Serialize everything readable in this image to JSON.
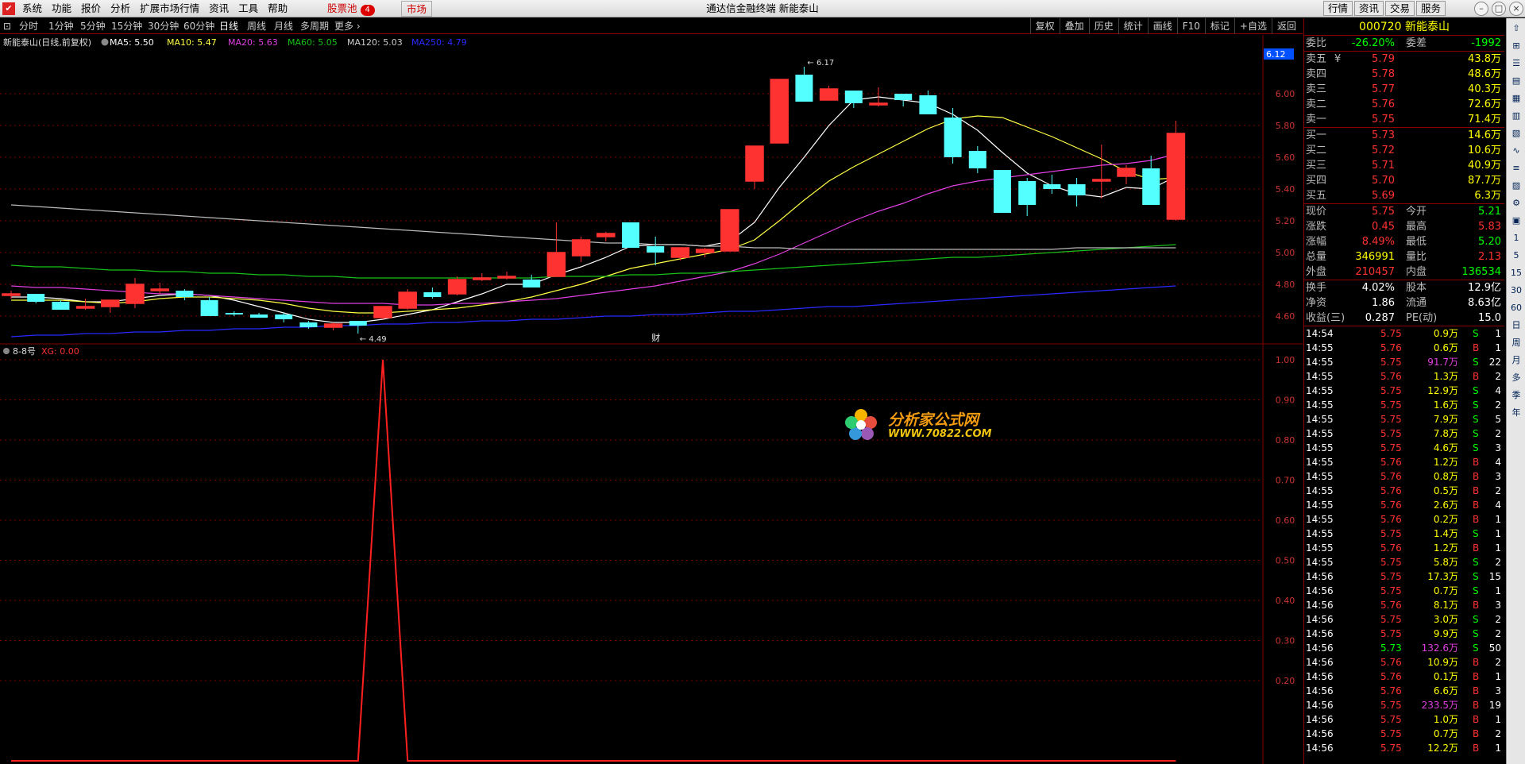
{
  "titlebar": {
    "menus": [
      "系统",
      "功能",
      "报价",
      "分析",
      "扩展市场行情",
      "资讯",
      "工具",
      "帮助"
    ],
    "stock_pool": "股票池",
    "stock_pool_badge": "4",
    "market": "市场",
    "app_title": "通达信金融终端  新能泰山",
    "buttons": [
      "行情",
      "资讯",
      "交易",
      "服务"
    ]
  },
  "periodbar": {
    "items": [
      "分时",
      "1分钟",
      "5分钟",
      "15分钟",
      "30分钟",
      "60分钟",
      "日线",
      "周线",
      "月线",
      "多周期",
      "更多"
    ],
    "active": "日线",
    "chart_buttons": [
      "复权",
      "叠加",
      "历史",
      "统计",
      "画线",
      "F10",
      "标记",
      "+自选",
      "返回"
    ]
  },
  "main_header": {
    "name": "新能泰山(日线,前复权)",
    "ma5": "MA5: 5.50",
    "ma10": "MA10: 5.47",
    "ma20": "MA20: 5.63",
    "ma60": "MA60: 5.05",
    "ma120": "MA120: 5.03",
    "ma250": "MA250: 4.79",
    "high_label": "6.17",
    "low_label": "4.49",
    "fin_label": "财",
    "price_tag": "6.12"
  },
  "sub_header": {
    "name": "8-8号",
    "value": "XG: 0.00"
  },
  "watermark": {
    "line1": "分析家公式网",
    "line2": "WWW.70822.COM"
  },
  "colors": {
    "up": "#ff3232",
    "down": "#54ffff",
    "ma5": "#ffffff",
    "ma10": "#ffff44",
    "ma20": "#e040e0",
    "ma60": "#18c018",
    "ma120": "#bbbbbb",
    "ma250": "#2a2aff",
    "grid": "#800000"
  },
  "chart_data": [
    {
      "type": "candlestick",
      "title": "新能泰山(日线,前复权)",
      "y_ticks": [
        4.6,
        4.8,
        5.0,
        5.2,
        5.4,
        5.6,
        5.8,
        6.0
      ],
      "ylim": [
        4.42,
        6.25
      ],
      "candles": [
        [
          4.73,
          4.76,
          4.71,
          4.74
        ],
        [
          4.74,
          4.74,
          4.68,
          4.69
        ],
        [
          4.69,
          4.7,
          4.64,
          4.64
        ],
        [
          4.65,
          4.71,
          4.64,
          4.66
        ],
        [
          4.66,
          4.7,
          4.62,
          4.7
        ],
        [
          4.68,
          4.84,
          4.65,
          4.8
        ],
        [
          4.76,
          4.81,
          4.74,
          4.77
        ],
        [
          4.76,
          4.77,
          4.7,
          4.72
        ],
        [
          4.7,
          4.72,
          4.6,
          4.6
        ],
        [
          4.62,
          4.63,
          4.6,
          4.61
        ],
        [
          4.61,
          4.62,
          4.59,
          4.59
        ],
        [
          4.61,
          4.62,
          4.56,
          4.58
        ],
        [
          4.56,
          4.57,
          4.52,
          4.53
        ],
        [
          4.53,
          4.56,
          4.51,
          4.55
        ],
        [
          4.57,
          4.57,
          4.49,
          4.54
        ],
        [
          4.59,
          4.66,
          4.58,
          4.66
        ],
        [
          4.65,
          4.77,
          4.64,
          4.75
        ],
        [
          4.75,
          4.78,
          4.71,
          4.72
        ],
        [
          4.74,
          4.85,
          4.73,
          4.83
        ],
        [
          4.83,
          4.87,
          4.82,
          4.84
        ],
        [
          4.84,
          4.88,
          4.83,
          4.85
        ],
        [
          4.83,
          4.86,
          4.78,
          4.78
        ],
        [
          4.85,
          5.19,
          4.85,
          5.0
        ],
        [
          4.98,
          5.1,
          4.94,
          5.08
        ],
        [
          5.1,
          5.13,
          5.07,
          5.12
        ],
        [
          5.19,
          5.19,
          5.03,
          5.03
        ],
        [
          5.04,
          5.1,
          4.92,
          5.0
        ],
        [
          4.97,
          5.02,
          4.95,
          5.03
        ],
        [
          5.0,
          5.03,
          4.97,
          5.02
        ],
        [
          5.01,
          5.27,
          5.01,
          5.27
        ],
        [
          5.45,
          5.57,
          5.4,
          5.67
        ],
        [
          5.69,
          6.04,
          5.69,
          6.09
        ],
        [
          6.12,
          6.17,
          5.96,
          5.95
        ],
        [
          5.96,
          6.05,
          5.96,
          6.03
        ],
        [
          6.02,
          6.02,
          5.91,
          5.94
        ],
        [
          5.93,
          6.04,
          5.92,
          5.94
        ],
        [
          6.0,
          6.0,
          5.92,
          5.96
        ],
        [
          5.99,
          6.02,
          5.87,
          5.87
        ],
        [
          5.85,
          5.91,
          5.56,
          5.6
        ],
        [
          5.64,
          5.67,
          5.5,
          5.53
        ],
        [
          5.52,
          5.52,
          5.26,
          5.25
        ],
        [
          5.45,
          5.47,
          5.23,
          5.3
        ],
        [
          5.43,
          5.49,
          5.37,
          5.4
        ],
        [
          5.43,
          5.47,
          5.29,
          5.36
        ],
        [
          5.45,
          5.68,
          5.34,
          5.46
        ],
        [
          5.48,
          5.55,
          5.43,
          5.53
        ],
        [
          5.53,
          5.61,
          5.33,
          5.3
        ],
        [
          5.21,
          5.83,
          5.2,
          5.75
        ]
      ],
      "series": [
        {
          "name": "MA5",
          "values": [
            4.72,
            4.72,
            4.71,
            4.69,
            4.69,
            4.71,
            4.73,
            4.74,
            4.73,
            4.7,
            4.66,
            4.62,
            4.58,
            4.56,
            4.56,
            4.58,
            4.61,
            4.64,
            4.69,
            4.74,
            4.8,
            4.8,
            4.86,
            4.91,
            4.97,
            5.04,
            5.05,
            5.05,
            5.04,
            5.07,
            5.19,
            5.41,
            5.6,
            5.8,
            5.96,
            5.98,
            5.96,
            5.94,
            5.87,
            5.77,
            5.63,
            5.5,
            5.42,
            5.37,
            5.35,
            5.41,
            5.4,
            5.48
          ]
        },
        {
          "name": "MA10",
          "values": [
            4.7,
            4.7,
            4.7,
            4.69,
            4.68,
            4.69,
            4.71,
            4.72,
            4.72,
            4.71,
            4.7,
            4.68,
            4.65,
            4.63,
            4.62,
            4.62,
            4.63,
            4.64,
            4.65,
            4.67,
            4.69,
            4.72,
            4.76,
            4.8,
            4.85,
            4.9,
            4.93,
            4.96,
            4.99,
            5.02,
            5.08,
            5.2,
            5.33,
            5.45,
            5.54,
            5.62,
            5.7,
            5.78,
            5.84,
            5.86,
            5.85,
            5.79,
            5.73,
            5.66,
            5.59,
            5.51,
            5.46,
            5.47
          ]
        },
        {
          "name": "MA20",
          "values": [
            4.79,
            4.78,
            4.78,
            4.77,
            4.76,
            4.75,
            4.74,
            4.74,
            4.73,
            4.72,
            4.71,
            4.7,
            4.69,
            4.68,
            4.68,
            4.68,
            4.67,
            4.67,
            4.68,
            4.68,
            4.69,
            4.7,
            4.71,
            4.73,
            4.75,
            4.77,
            4.79,
            4.82,
            4.85,
            4.88,
            4.93,
            4.99,
            5.06,
            5.13,
            5.2,
            5.26,
            5.31,
            5.37,
            5.42,
            5.45,
            5.47,
            5.49,
            5.51,
            5.53,
            5.55,
            5.56,
            5.58,
            5.62
          ]
        },
        {
          "name": "MA60",
          "values": [
            4.92,
            4.91,
            4.91,
            4.9,
            4.89,
            4.89,
            4.88,
            4.88,
            4.87,
            4.87,
            4.86,
            4.86,
            4.85,
            4.85,
            4.84,
            4.84,
            4.84,
            4.84,
            4.84,
            4.84,
            4.84,
            4.84,
            4.85,
            4.85,
            4.85,
            4.86,
            4.86,
            4.87,
            4.87,
            4.88,
            4.89,
            4.9,
            4.91,
            4.92,
            4.93,
            4.94,
            4.95,
            4.96,
            4.97,
            4.97,
            4.98,
            4.99,
            5.0,
            5.01,
            5.02,
            5.03,
            5.04,
            5.05
          ]
        },
        {
          "name": "MA120",
          "values": [
            5.3,
            5.29,
            5.28,
            5.27,
            5.26,
            5.25,
            5.24,
            5.23,
            5.22,
            5.21,
            5.2,
            5.19,
            5.18,
            5.17,
            5.16,
            5.15,
            5.14,
            5.13,
            5.12,
            5.11,
            5.1,
            5.09,
            5.08,
            5.07,
            5.06,
            5.06,
            5.05,
            5.05,
            5.04,
            5.04,
            5.03,
            5.03,
            5.02,
            5.02,
            5.02,
            5.02,
            5.02,
            5.02,
            5.02,
            5.02,
            5.02,
            5.02,
            5.02,
            5.03,
            5.03,
            5.03,
            5.03,
            5.03
          ]
        },
        {
          "name": "MA250",
          "values": [
            4.47,
            4.48,
            4.48,
            4.49,
            4.49,
            4.5,
            4.5,
            4.51,
            4.51,
            4.52,
            4.52,
            4.53,
            4.53,
            4.54,
            4.54,
            4.55,
            4.55,
            4.56,
            4.56,
            4.57,
            4.57,
            4.58,
            4.58,
            4.59,
            4.6,
            4.6,
            4.61,
            4.61,
            4.62,
            4.63,
            4.63,
            4.64,
            4.65,
            4.66,
            4.66,
            4.67,
            4.68,
            4.69,
            4.7,
            4.71,
            4.72,
            4.73,
            4.74,
            4.75,
            4.76,
            4.77,
            4.78,
            4.79
          ]
        }
      ]
    },
    {
      "type": "line",
      "title": "8-8号",
      "y_ticks": [
        0.2,
        0.3,
        0.4,
        0.5,
        0.6,
        0.7,
        0.8,
        0.9,
        1.0
      ],
      "ylim": [
        0,
        1.0
      ],
      "series": [
        {
          "name": "XG",
          "values": [
            0,
            0,
            0,
            0,
            0,
            0,
            0,
            0,
            0,
            0,
            0,
            0,
            0,
            0,
            0,
            1,
            0,
            0,
            0,
            0,
            0,
            0,
            0,
            0,
            0,
            0,
            0,
            0,
            0,
            0,
            0,
            0,
            0,
            0,
            0,
            0,
            0,
            0,
            0,
            0,
            0,
            0,
            0,
            0,
            0,
            0,
            0,
            0
          ]
        }
      ]
    }
  ],
  "quote": {
    "code": "000720",
    "name": "新能泰山",
    "weibi_label": "委比",
    "weibi": "-26.20%",
    "weicha_label": "委差",
    "weicha": "-1992",
    "asks": [
      {
        "label": "卖五",
        "mark": "¥",
        "price": "5.79",
        "vol": "43.8万"
      },
      {
        "label": "卖四",
        "mark": "",
        "price": "5.78",
        "vol": "48.6万"
      },
      {
        "label": "卖三",
        "mark": "",
        "price": "5.77",
        "vol": "40.3万"
      },
      {
        "label": "卖二",
        "mark": "",
        "price": "5.76",
        "vol": "72.6万"
      },
      {
        "label": "卖一",
        "mark": "",
        "price": "5.75",
        "vol": "71.4万"
      }
    ],
    "bids": [
      {
        "label": "买一",
        "price": "5.73",
        "vol": "14.6万"
      },
      {
        "label": "买二",
        "price": "5.72",
        "vol": "10.6万"
      },
      {
        "label": "买三",
        "price": "5.71",
        "vol": "40.9万"
      },
      {
        "label": "买四",
        "price": "5.70",
        "vol": "87.7万"
      },
      {
        "label": "买五",
        "price": "5.69",
        "vol": "6.3万"
      }
    ],
    "stats": [
      {
        "l1": "现价",
        "v1": "5.75",
        "c1": "red",
        "l2": "今开",
        "v2": "5.21",
        "c2": "green"
      },
      {
        "l1": "涨跌",
        "v1": "0.45",
        "c1": "red",
        "l2": "最高",
        "v2": "5.83",
        "c2": "red"
      },
      {
        "l1": "涨幅",
        "v1": "8.49%",
        "c1": "red",
        "l2": "最低",
        "v2": "5.20",
        "c2": "green"
      },
      {
        "l1": "总量",
        "v1": "346991",
        "c1": "yellow",
        "l2": "量比",
        "v2": "2.13",
        "c2": "red"
      },
      {
        "l1": "外盘",
        "v1": "210457",
        "c1": "red",
        "l2": "内盘",
        "v2": "136534",
        "c2": "green"
      }
    ],
    "fin": [
      {
        "l1": "换手",
        "v1": "4.02%",
        "l2": "股本",
        "v2": "12.9亿"
      },
      {
        "l1": "净资",
        "v1": "1.86",
        "l2": "流通",
        "v2": "8.63亿"
      },
      {
        "l1": "收益(三)",
        "v1": "0.287",
        "l2": "PE(动)",
        "v2": "15.0"
      }
    ],
    "ticks": [
      [
        "14:54",
        "5.75",
        "0.9万",
        "S",
        "1"
      ],
      [
        "14:55",
        "5.76",
        "0.6万",
        "B",
        "1"
      ],
      [
        "14:55",
        "5.75",
        "91.7万",
        "S",
        "22"
      ],
      [
        "14:55",
        "5.76",
        "1.3万",
        "B",
        "2"
      ],
      [
        "14:55",
        "5.75",
        "12.9万",
        "S",
        "4"
      ],
      [
        "14:55",
        "5.75",
        "1.6万",
        "S",
        "2"
      ],
      [
        "14:55",
        "5.75",
        "7.9万",
        "S",
        "5"
      ],
      [
        "14:55",
        "5.75",
        "7.8万",
        "S",
        "2"
      ],
      [
        "14:55",
        "5.75",
        "4.6万",
        "S",
        "3"
      ],
      [
        "14:55",
        "5.76",
        "1.2万",
        "B",
        "4"
      ],
      [
        "14:55",
        "5.76",
        "0.8万",
        "B",
        "3"
      ],
      [
        "14:55",
        "5.76",
        "0.5万",
        "B",
        "2"
      ],
      [
        "14:55",
        "5.76",
        "2.6万",
        "B",
        "4"
      ],
      [
        "14:55",
        "5.76",
        "0.2万",
        "B",
        "1"
      ],
      [
        "14:55",
        "5.75",
        "1.4万",
        "S",
        "1"
      ],
      [
        "14:55",
        "5.76",
        "1.2万",
        "B",
        "1"
      ],
      [
        "14:55",
        "5.75",
        "5.8万",
        "S",
        "2"
      ],
      [
        "14:56",
        "5.75",
        "17.3万",
        "S",
        "15"
      ],
      [
        "14:56",
        "5.75",
        "0.7万",
        "S",
        "1"
      ],
      [
        "14:56",
        "5.76",
        "8.1万",
        "B",
        "3"
      ],
      [
        "14:56",
        "5.75",
        "3.0万",
        "S",
        "2"
      ],
      [
        "14:56",
        "5.75",
        "9.9万",
        "S",
        "2"
      ],
      [
        "14:56",
        "5.73",
        "132.6万",
        "S",
        "50"
      ],
      [
        "14:56",
        "5.76",
        "10.9万",
        "B",
        "2"
      ],
      [
        "14:56",
        "5.76",
        "0.1万",
        "B",
        "1"
      ],
      [
        "14:56",
        "5.76",
        "6.6万",
        "B",
        "3"
      ],
      [
        "14:56",
        "5.75",
        "233.5万",
        "B",
        "19"
      ],
      [
        "14:56",
        "5.75",
        "1.0万",
        "B",
        "1"
      ],
      [
        "14:56",
        "5.75",
        "0.7万",
        "B",
        "2"
      ],
      [
        "14:56",
        "5.75",
        "12.2万",
        "B",
        "1"
      ]
    ]
  },
  "right_toolbar": [
    "1",
    "5",
    "15",
    "30",
    "60",
    "日",
    "周",
    "月",
    "多",
    "季",
    "年"
  ]
}
